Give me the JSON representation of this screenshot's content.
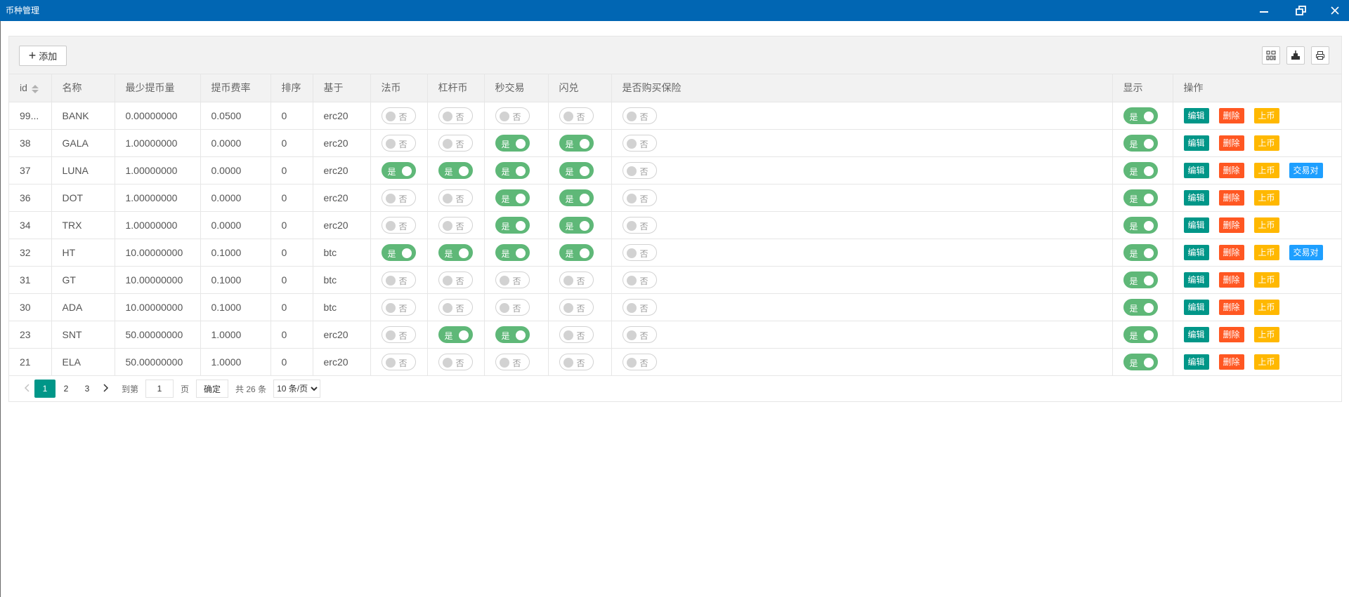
{
  "window": {
    "title": "币种管理"
  },
  "toolbar": {
    "add_label": "添加"
  },
  "table": {
    "headers": {
      "id": "id",
      "name": "名称",
      "min_withdraw": "最少提币量",
      "fee_rate": "提币费率",
      "sort": "排序",
      "based_on": "基于",
      "fiat": "法币",
      "leverage": "杠杆币",
      "second_trade": "秒交易",
      "flash": "闪兑",
      "insurance": "是否购买保险",
      "display": "显示",
      "actions": "操作"
    },
    "switch_on_label": "是",
    "switch_off_label": "否",
    "action_labels": {
      "edit": "编辑",
      "delete": "删除",
      "list": "上币",
      "pair": "交易对"
    },
    "rows": [
      {
        "id": "99...",
        "name": "BANK",
        "min_withdraw": "0.00000000",
        "fee_rate": "0.0500",
        "sort": "0",
        "based_on": "erc20",
        "fiat": false,
        "leverage": false,
        "second_trade": false,
        "flash": false,
        "insurance": false,
        "display": true,
        "has_pair": false
      },
      {
        "id": "38",
        "name": "GALA",
        "min_withdraw": "1.00000000",
        "fee_rate": "0.0000",
        "sort": "0",
        "based_on": "erc20",
        "fiat": false,
        "leverage": false,
        "second_trade": true,
        "flash": true,
        "insurance": false,
        "display": true,
        "has_pair": false
      },
      {
        "id": "37",
        "name": "LUNA",
        "min_withdraw": "1.00000000",
        "fee_rate": "0.0000",
        "sort": "0",
        "based_on": "erc20",
        "fiat": true,
        "leverage": true,
        "second_trade": true,
        "flash": true,
        "insurance": false,
        "display": true,
        "has_pair": true
      },
      {
        "id": "36",
        "name": "DOT",
        "min_withdraw": "1.00000000",
        "fee_rate": "0.0000",
        "sort": "0",
        "based_on": "erc20",
        "fiat": false,
        "leverage": false,
        "second_trade": true,
        "flash": true,
        "insurance": false,
        "display": true,
        "has_pair": false
      },
      {
        "id": "34",
        "name": "TRX",
        "min_withdraw": "1.00000000",
        "fee_rate": "0.0000",
        "sort": "0",
        "based_on": "erc20",
        "fiat": false,
        "leverage": false,
        "second_trade": true,
        "flash": true,
        "insurance": false,
        "display": true,
        "has_pair": false
      },
      {
        "id": "32",
        "name": "HT",
        "min_withdraw": "10.00000000",
        "fee_rate": "0.1000",
        "sort": "0",
        "based_on": "btc",
        "fiat": true,
        "leverage": true,
        "second_trade": true,
        "flash": true,
        "insurance": false,
        "display": true,
        "has_pair": true
      },
      {
        "id": "31",
        "name": "GT",
        "min_withdraw": "10.00000000",
        "fee_rate": "0.1000",
        "sort": "0",
        "based_on": "btc",
        "fiat": false,
        "leverage": false,
        "second_trade": false,
        "flash": false,
        "insurance": false,
        "display": true,
        "has_pair": false
      },
      {
        "id": "30",
        "name": "ADA",
        "min_withdraw": "10.00000000",
        "fee_rate": "0.1000",
        "sort": "0",
        "based_on": "btc",
        "fiat": false,
        "leverage": false,
        "second_trade": false,
        "flash": false,
        "insurance": false,
        "display": true,
        "has_pair": false
      },
      {
        "id": "23",
        "name": "SNT",
        "min_withdraw": "50.00000000",
        "fee_rate": "1.0000",
        "sort": "0",
        "based_on": "erc20",
        "fiat": false,
        "leverage": true,
        "second_trade": true,
        "flash": false,
        "insurance": false,
        "display": true,
        "has_pair": false
      },
      {
        "id": "21",
        "name": "ELA",
        "min_withdraw": "50.00000000",
        "fee_rate": "1.0000",
        "sort": "0",
        "based_on": "erc20",
        "fiat": false,
        "leverage": false,
        "second_trade": false,
        "flash": false,
        "insurance": false,
        "display": true,
        "has_pair": false
      }
    ]
  },
  "pagination": {
    "pages": [
      "1",
      "2",
      "3"
    ],
    "current": "1",
    "goto_label": "到第",
    "goto_value": "1",
    "page_label": "页",
    "confirm_label": "确定",
    "total_label": "共 26 条",
    "page_size_option": "10 条/页"
  },
  "colors": {
    "titlebar": "#0166b3",
    "switch_on": "#5fb878",
    "edit": "#009688",
    "delete": "#ff5722",
    "list": "#ffb800",
    "pair": "#1e9fff",
    "active_page": "#009688"
  }
}
